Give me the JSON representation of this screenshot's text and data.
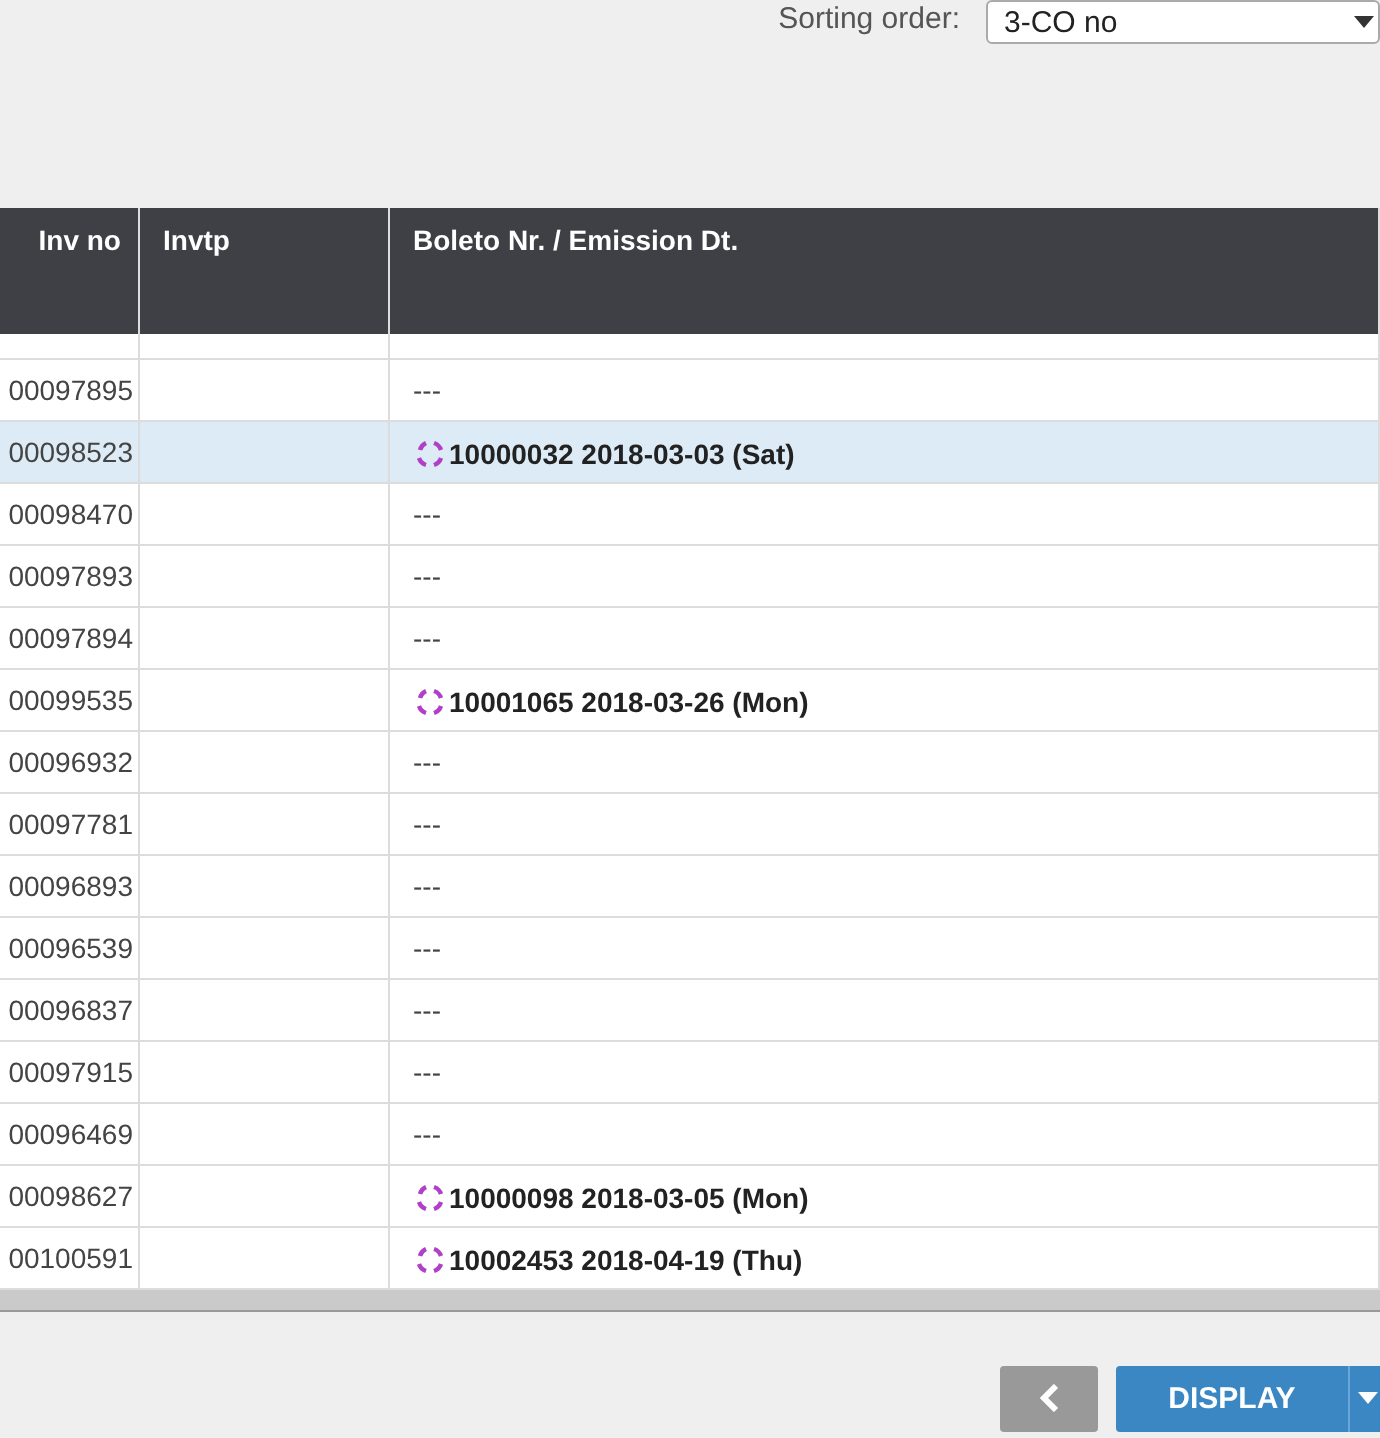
{
  "sorting": {
    "label": "Sorting order:",
    "value": "3-CO no"
  },
  "table": {
    "columns": [
      "Inv no",
      "Invtp",
      "Boleto Nr. / Emission Dt."
    ],
    "rows": [
      {
        "inv_no": "00097895",
        "invtp": "",
        "kind": "empty",
        "boleto": "---",
        "selected": false
      },
      {
        "inv_no": "00098523",
        "invtp": "",
        "kind": "boleto",
        "boleto": "10000032 2018-03-03 (Sat)",
        "selected": true
      },
      {
        "inv_no": "00098470",
        "invtp": "",
        "kind": "empty",
        "boleto": "---",
        "selected": false
      },
      {
        "inv_no": "00097893",
        "invtp": "",
        "kind": "empty",
        "boleto": "---",
        "selected": false
      },
      {
        "inv_no": "00097894",
        "invtp": "",
        "kind": "empty",
        "boleto": "---",
        "selected": false
      },
      {
        "inv_no": "00099535",
        "invtp": "",
        "kind": "boleto",
        "boleto": "10001065 2018-03-26 (Mon)",
        "selected": false
      },
      {
        "inv_no": "00096932",
        "invtp": "",
        "kind": "empty",
        "boleto": "---",
        "selected": false
      },
      {
        "inv_no": "00097781",
        "invtp": "",
        "kind": "empty",
        "boleto": "---",
        "selected": false
      },
      {
        "inv_no": "00096893",
        "invtp": "",
        "kind": "empty",
        "boleto": "---",
        "selected": false
      },
      {
        "inv_no": "00096539",
        "invtp": "",
        "kind": "empty",
        "boleto": "---",
        "selected": false
      },
      {
        "inv_no": "00096837",
        "invtp": "",
        "kind": "empty",
        "boleto": "---",
        "selected": false
      },
      {
        "inv_no": "00097915",
        "invtp": "",
        "kind": "empty",
        "boleto": "---",
        "selected": false
      },
      {
        "inv_no": "00096469",
        "invtp": "",
        "kind": "empty",
        "boleto": "---",
        "selected": false
      },
      {
        "inv_no": "00098627",
        "invtp": "",
        "kind": "boleto",
        "boleto": "10000098 2018-03-05 (Mon)",
        "selected": false
      },
      {
        "inv_no": "00100591",
        "invtp": "",
        "kind": "boleto",
        "boleto": "10002453 2018-04-19 (Thu)",
        "selected": false
      }
    ]
  },
  "buttons": {
    "primary": "DISPLAY"
  }
}
